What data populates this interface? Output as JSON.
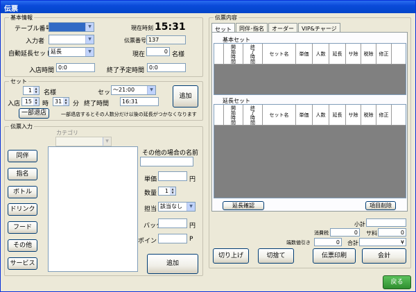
{
  "window": {
    "title": "伝票"
  },
  "basic": {
    "label": "基本情報",
    "table_label": "テーブル番号",
    "input_label": "入力者",
    "auto_set_label": "自動延長セット",
    "auto_set_value": "延長",
    "current_time_label": "現在時刻",
    "current_time": "15:31",
    "slip_no_label": "伝票番号",
    "slip_no": "137",
    "now_label": "現在",
    "now_count": "0",
    "now_unit": "名様",
    "entry_label": "入店時間",
    "entry_value": "0:0",
    "end_label": "終了予定時間",
    "end_value": "0:0"
  },
  "set": {
    "label": "セット",
    "count": "1",
    "count_unit": "名様",
    "set_label": "セット",
    "set_value": "～21:00",
    "entry_label": "入店",
    "hour": "15",
    "hour_unit": "時",
    "minute": "31",
    "minute_unit": "分",
    "end_label": "終了時間",
    "end_value": "16:31",
    "add_label": "追加",
    "partial_leave_label": "一部退店",
    "note": "一部退店するとその人数分だけ以後の延長がつかなくなります"
  },
  "slip_input": {
    "label": "伝票入力",
    "category_label": "カテゴリ",
    "buttons": [
      "同伴",
      "指名",
      "ボトル",
      "ドリンク",
      "フード",
      "その他",
      "サービス"
    ],
    "other_name_label": "その他の場合の名前",
    "price_label": "単価",
    "price_unit": "円",
    "qty_label": "数量",
    "qty": "1",
    "charge_label": "担当",
    "charge_value": "該当なし",
    "back_label": "バック",
    "back_unit": "円",
    "point_label": "ポイント",
    "point_unit": "P",
    "add_label": "追加"
  },
  "slip_content": {
    "label": "伝票内容",
    "tabs": [
      "セット",
      "同伴･指名",
      "オーダー",
      "VIP&チャージ"
    ],
    "basic_set_label": "基本セット",
    "ext_set_label": "延長セット",
    "columns": [
      "開始時間",
      "終了時間",
      "セット名",
      "単価",
      "人数",
      "延長",
      "サ除",
      "税除",
      "修正"
    ],
    "ext_confirm": "延長確認",
    "delete_item": "項目削除"
  },
  "totals": {
    "subtotal_label": "小計",
    "subtotal": "",
    "tax_label": "消費税",
    "tax": "0",
    "service_label": "サ料",
    "service": "0",
    "rounding_label": "端数値引き",
    "rounding": "0",
    "total_label": "合計",
    "total": "¥"
  },
  "actions": {
    "round_up": "切り上げ",
    "round_down": "切捨て",
    "print": "伝票印刷",
    "checkout": "会計",
    "back": "戻る"
  }
}
